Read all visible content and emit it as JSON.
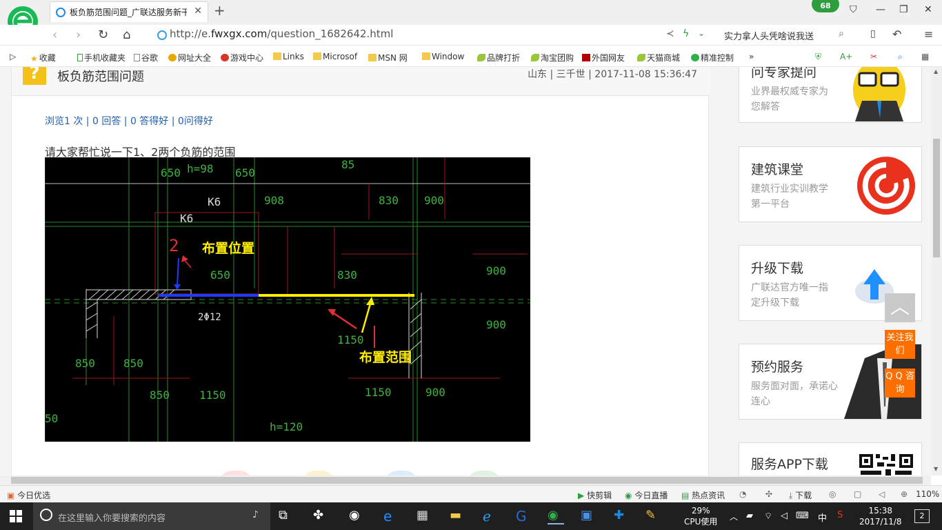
{
  "browser": {
    "tab_title": "板负筋范围问题_广联达服务新干线",
    "url_prefix": "http://e.",
    "url_domain": "fwxgx.com",
    "url_path": "/question_1682642.html",
    "notification_count": "68",
    "search_text": "实力拿人头凭啥说我送"
  },
  "bookmarks": [
    {
      "label": "收藏",
      "icon": "star-icon"
    },
    {
      "label": "手机收藏夹",
      "icon": "phone-icon"
    },
    {
      "label": "谷歌",
      "icon": "page-icon"
    },
    {
      "label": "网址大全",
      "icon": "globe-icon"
    },
    {
      "label": "游戏中心",
      "icon": "game-icon"
    },
    {
      "label": "Links",
      "icon": "folder-icon"
    },
    {
      "label": "Microsof",
      "icon": "folder-icon"
    },
    {
      "label": "MSN 网",
      "icon": "folder-icon"
    },
    {
      "label": "Window",
      "icon": "folder-icon"
    },
    {
      "label": "品牌打折",
      "icon": "leaf-icon"
    },
    {
      "label": "淘宝团购",
      "icon": "leaf-icon"
    },
    {
      "label": "外国网友",
      "icon": "flag-icon"
    },
    {
      "label": "天猫商城",
      "icon": "leaf-icon"
    },
    {
      "label": "精准控制",
      "icon": "chat-icon"
    }
  ],
  "question": {
    "title": "板负筋范围问题",
    "meta": "山东 | 三千世 | 2017-11-08 15:36:47",
    "stats": "浏览1 次 | 0 回答 | 0 答得好 | 0问得好",
    "body": "请大家帮忙说一下1、2两个负筋的范围"
  },
  "cad": {
    "labels": {
      "t650a": "650",
      "th98": "h=98",
      "t650b": "650",
      "t85": "85",
      "t908": "908",
      "t830": "830",
      "t900a": "900",
      "tk6a": "K6",
      "tk6b": "K6",
      "t2red": "2",
      "placement_position": "布置位置",
      "t650c": "650",
      "t830b": "830",
      "t900b": "900",
      "t2phi12": "2Φ12",
      "t900c": "900",
      "t1150a": "1150",
      "placement_range": "布置范围",
      "t850a": "850",
      "t850b": "850",
      "t850c": "850",
      "t1150b": "1150",
      "t1150c": "1150",
      "t900d": "900",
      "t50": "50",
      "th120": "h=120"
    }
  },
  "sidebar": {
    "card1": {
      "title": "问专家提问",
      "desc": "业界最权威专家为您解答"
    },
    "card2": {
      "title": "建筑课堂",
      "desc": "建筑行业实训教学第一平台"
    },
    "card3": {
      "title": "升级下载",
      "desc": "广联达官方唯一指定升级下载"
    },
    "card4": {
      "title": "预约服务",
      "desc": "服务面对面，承诺心连心"
    },
    "card5": {
      "title": "服务APP下载"
    },
    "follow_btn": "关注我们",
    "qq_btn": "Q Q 咨询"
  },
  "statusbar": {
    "left": "今日优选",
    "items": [
      "快剪辑",
      "今日直播",
      "热点资讯",
      "下载"
    ],
    "zoom": "110%"
  },
  "taskbar": {
    "search_placeholder": "在这里输入你要搜索的内容",
    "cpu_value": "29%",
    "cpu_label": "CPU使用",
    "ime": "中",
    "time": "15:38",
    "date": "2017/11/8",
    "notif": "2"
  }
}
